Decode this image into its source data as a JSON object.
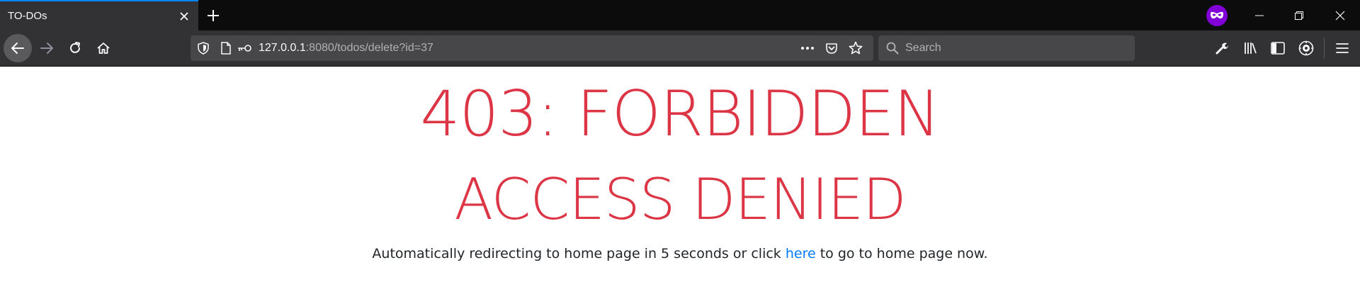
{
  "browser": {
    "tab": {
      "title": "TO-DOs"
    },
    "url": {
      "host": "127.0.0.1",
      "rest": ":8080/todos/delete?id=37"
    },
    "search": {
      "placeholder": "Search"
    },
    "colors": {
      "accent": "#0a84ff",
      "private": "#8000d7"
    }
  },
  "page": {
    "error_code": "403: FORBIDDEN",
    "error_message": "ACCESS DENIED",
    "redirect": {
      "before": "Automatically redirecting to home page in 5 seconds or click ",
      "link": "here",
      "after": " to go to home page now."
    },
    "colors": {
      "error": "#dc3545",
      "link": "#007bff"
    }
  }
}
